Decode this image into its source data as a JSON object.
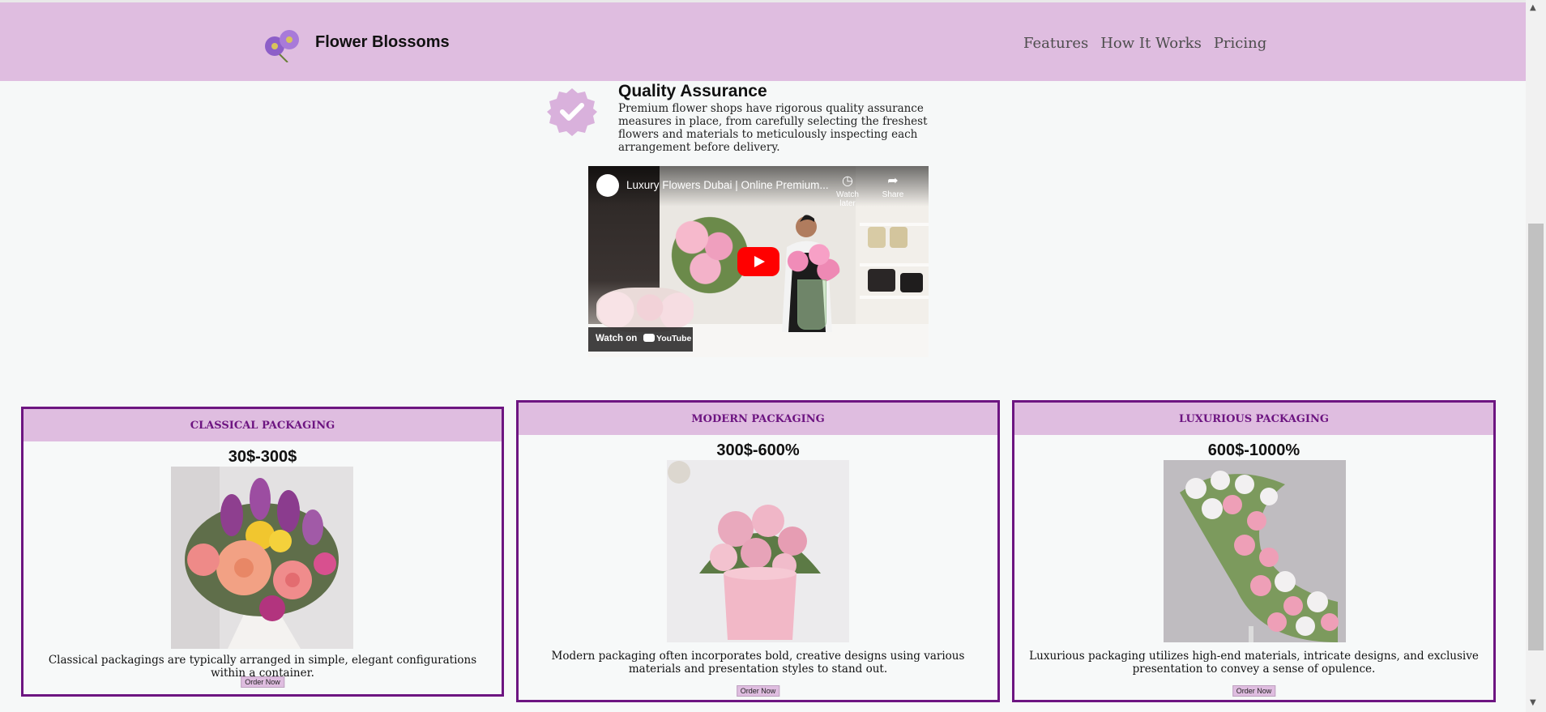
{
  "header": {
    "brand": "Flower Blossoms",
    "nav": [
      "Features",
      "How It Works",
      "Pricing"
    ]
  },
  "quality": {
    "title": "Quality Assurance",
    "text": "Premium flower shops have rigorous quality assurance measures in place, from carefully selecting the freshest flowers and materials to meticulously inspecting each arrangement before delivery."
  },
  "video": {
    "title": "Luxury Flowers Dubai | Online Premium...",
    "watch_later": "Watch later",
    "share": "Share",
    "watch_on": "Watch on",
    "youtube": "YouTube"
  },
  "cards": [
    {
      "title": "CLASSICAL PACKAGING",
      "price": "30$-300$",
      "desc": "Classical packagings are typically arranged in simple, elegant configurations within a container.",
      "button": "Order Now"
    },
    {
      "title": "MODERN PACKAGING",
      "price": "300$-600%",
      "desc": "Modern packaging often incorporates bold, creative designs using various materials and presentation styles to stand out.",
      "button": "Order Now"
    },
    {
      "title": "LUXURIOUS PACKAGING",
      "price": "600$-1000%",
      "desc": "Luxurious packaging utilizes high-end materials, intricate designs, and exclusive presentation to convey a sense of opulence.",
      "button": "Order Now"
    }
  ],
  "colors": {
    "header_bg": "#dfbde0",
    "accent_purple": "#6d1581",
    "page_bg": "#f6f8f8",
    "youtube_red": "#ff0000"
  }
}
